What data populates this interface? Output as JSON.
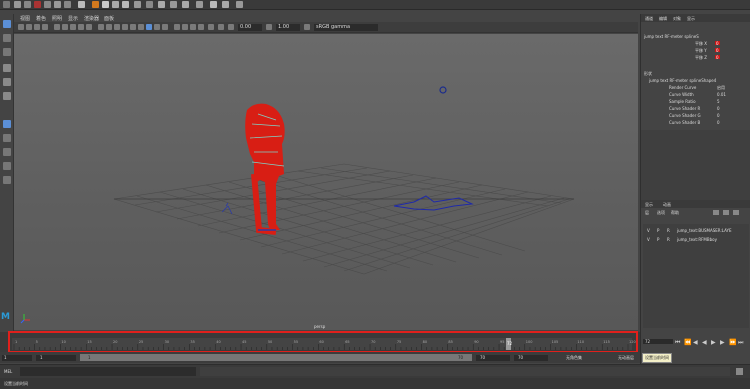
{
  "panel_menu": [
    "视图",
    "着色",
    "照明",
    "显示",
    "渲染器",
    "面板"
  ],
  "panel_toolbar": {
    "field1": "0.00",
    "field2": "1.00",
    "color_space": "sRGB gamma"
  },
  "right": {
    "tabs": [
      "通道",
      "编辑",
      "对象",
      "显示"
    ],
    "node_name": "jump text RF-meter splineS",
    "attrs": [
      {
        "label": "平移 X",
        "value": "0"
      },
      {
        "label": "平移 Y",
        "value": "0"
      },
      {
        "label": "平移 Z",
        "value": "0"
      }
    ],
    "shapes_label": "形状",
    "shape_node": "jump text RF-meter splineShape4",
    "shape_attrs": [
      {
        "label": "Render Curve",
        "value": "启用"
      },
      {
        "label": "Curve Width",
        "value": "0.01"
      },
      {
        "label": "Sample Ratio",
        "value": "5"
      },
      {
        "label": "Curve Shader R",
        "value": "0"
      },
      {
        "label": "Curve Shader G",
        "value": "0"
      },
      {
        "label": "Curve Shader B",
        "value": "0"
      }
    ],
    "layer_tabs": [
      "显示",
      "动画"
    ],
    "layer_menu": [
      "层",
      "选项",
      "帮助"
    ],
    "layers": [
      {
        "v": "V",
        "p": "P",
        "r": "R",
        "name": "jump_text:BUSMASER:LAYE"
      },
      {
        "v": "V",
        "p": "P",
        "r": "R",
        "name": "jump_text:RFMBboy"
      }
    ]
  },
  "timeline": {
    "ticks": [
      "1",
      "5",
      "10",
      "15",
      "20",
      "25",
      "30",
      "35",
      "40",
      "45",
      "50",
      "55",
      "60",
      "65",
      "70",
      "75",
      "80",
      "85",
      "90",
      "95",
      "100",
      "105",
      "110",
      "115",
      "120"
    ],
    "current_frame": "72"
  },
  "range": {
    "start": "1",
    "inner_start": "1",
    "inner_end": "70",
    "end": "70",
    "end2": "70",
    "no_char": "无角色集",
    "anim_layer": "无动画层",
    "tooltip": "设置当前时间"
  },
  "command_line": {
    "label": "MEL"
  },
  "help_line": "设置当前时间",
  "current_frame_field": "72",
  "colors": {
    "character": "#d81e14",
    "highlight": "#e0201c",
    "background": "#5f5f5f"
  }
}
